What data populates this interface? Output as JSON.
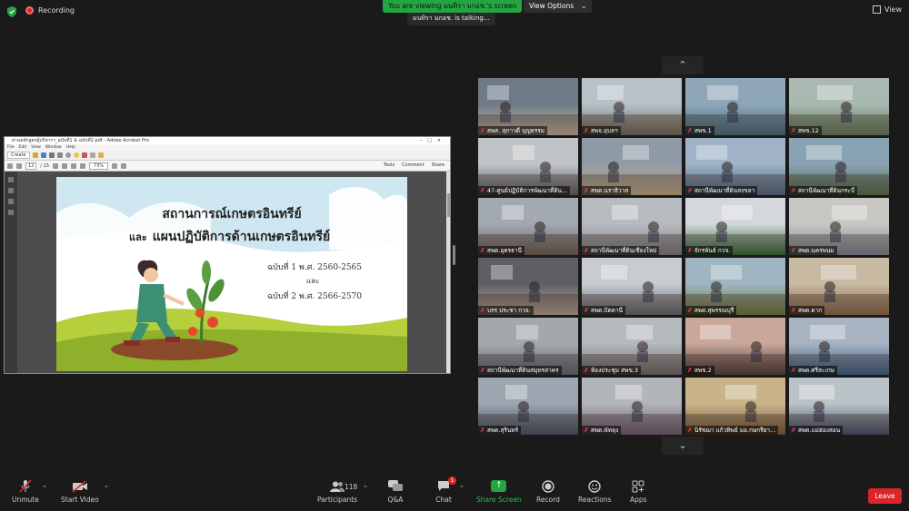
{
  "topbar": {
    "recording_label": "Recording",
    "viewing_banner": "You are viewing มนทิรา มกอช.'s screen",
    "view_options_label": "View Options",
    "talking_banner": "มนทิรา มกอช. is talking...",
    "view_label": "View"
  },
  "shared_window": {
    "title": "ผ่านหลักสูตรผู้บริหารฯ_ฉบับที่1 & ฉบับที่2.pdf - Adobe Acrobat Pro",
    "menu": [
      "File",
      "Edit",
      "View",
      "Window",
      "Help"
    ],
    "create_label": "Create",
    "page_current": "12",
    "page_total": "/ 15",
    "zoom": "73%",
    "right_tabs": [
      "Tools",
      "Comment",
      "Share"
    ]
  },
  "slide": {
    "title_line1": "สถานการณ์เกษตรอินทรีย์",
    "title_and": "และ",
    "title_line2": "แผนปฏิบัติการด้านเกษตรอินทรีย์",
    "edition1": "ฉบับที่ 1 พ.ศ. 2560-2565",
    "edition_and": "และ",
    "edition2": "ฉบับที่ 2 พ.ศ. 2566-2570"
  },
  "gallery": {
    "tiles": [
      {
        "name": "สพส. สุภาวดี  บุญธรรม"
      },
      {
        "name": "สพจ.อุบลฯ"
      },
      {
        "name": "สพข.1"
      },
      {
        "name": "สพข.12"
      },
      {
        "name": "47-ศูนย์ปฏิบัติการพัฒนาที่ดิน..."
      },
      {
        "name": "สพด.นราธิวาส"
      },
      {
        "name": "สถานีพัฒนาที่ดินสงขลา"
      },
      {
        "name": "สถานีพัฒนาที่ดินกระบี่"
      },
      {
        "name": "สพด.อุดรธานี"
      },
      {
        "name": "สถานีพัฒนาที่ดินเชียงใหม่"
      },
      {
        "name": "จักรพันธ์ กวจ."
      },
      {
        "name": "สพด.นครพนม"
      },
      {
        "name": "บรร ประชา กวจ."
      },
      {
        "name": "สพด.ปัตตานี"
      },
      {
        "name": "สพด.สุพรรณบุรี"
      },
      {
        "name": "สพด.ตาก"
      },
      {
        "name": "สถานีพัฒนาที่ดินสมุทรสาคร"
      },
      {
        "name": "ห้องประชุม สพข.3"
      },
      {
        "name": "สพข.2"
      },
      {
        "name": "สพด.ศรีสะเกษ"
      },
      {
        "name": "สพด.สุรินทร์"
      },
      {
        "name": "สพด.พัทลุง"
      },
      {
        "name": "นิรัชฌา แก้วทิพย์ มอ.กษกรียา..."
      },
      {
        "name": "สพด.แม่ฮ่องสอน"
      }
    ]
  },
  "toolbar": {
    "unmute": "Unmute",
    "start_video": "Start Video",
    "participants": "Participants",
    "participants_count": "118",
    "qa": "Q&A",
    "chat": "Chat",
    "chat_badge": "1",
    "share_screen": "Share Screen",
    "record": "Record",
    "reactions": "Reactions",
    "apps": "Apps",
    "leave": "Leave"
  },
  "colors": {
    "background": "#1a1a1a",
    "share_green": "#23a642",
    "leave_red": "#d9262c",
    "muted_red": "#ff4040"
  }
}
